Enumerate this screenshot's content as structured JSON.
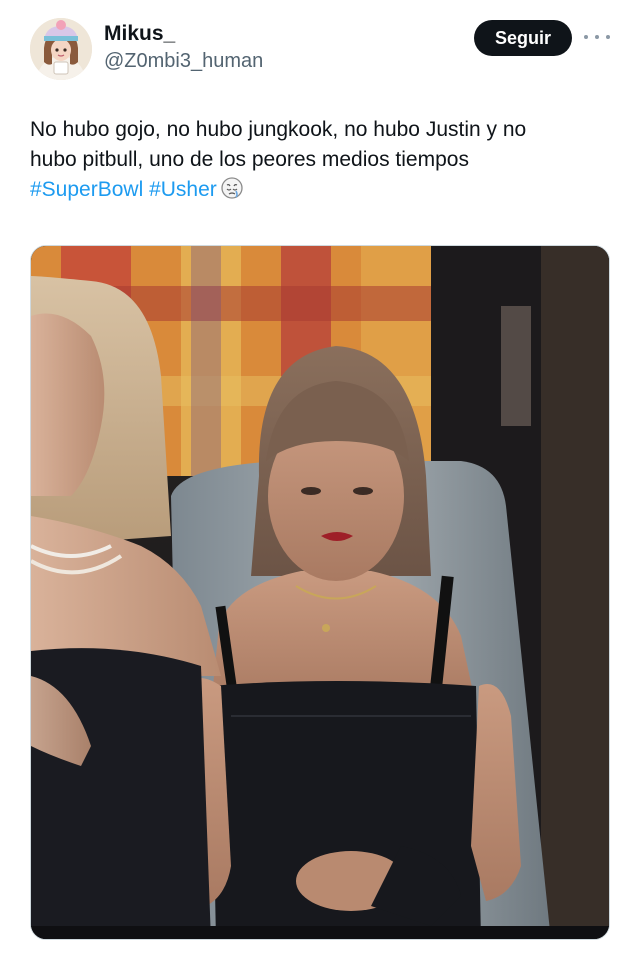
{
  "author": {
    "display_name": "Mikus_",
    "handle": "@Z0mbi3_human",
    "avatar_icon": "avatar-illustration"
  },
  "actions": {
    "follow_label": "Seguir",
    "more_icon": "more-horizontal-icon"
  },
  "tweet": {
    "line1": "No hubo gojo, no hubo jungkook, no hubo Justin y no",
    "line2": "hubo pitbull, uno de los peores medios tiempos",
    "hashtag1": "#SuperBowl",
    "hashtag2": "#Usher",
    "emoji_icon": "pensive-face-emoji-icon"
  },
  "media": {
    "type": "photo"
  },
  "colors": {
    "text": "#0f1419",
    "secondary": "#536471",
    "link": "#1d9bf0",
    "follow_bg": "#0f1419"
  }
}
